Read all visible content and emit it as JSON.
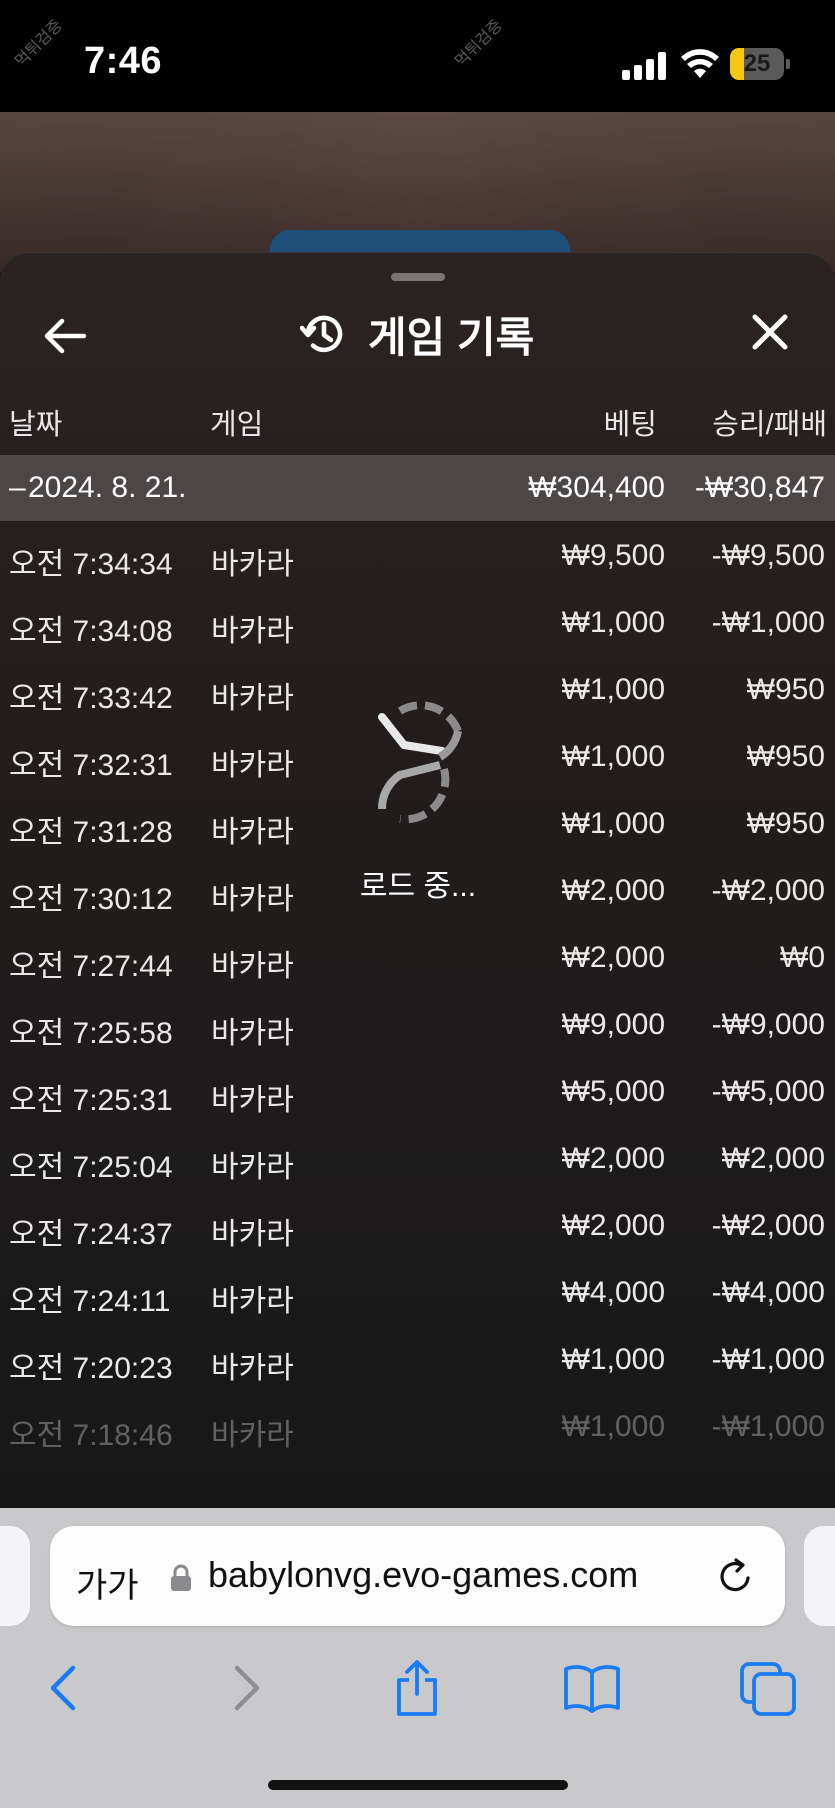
{
  "status_bar": {
    "time": "7:46",
    "battery": "25"
  },
  "sheet": {
    "title": "게임 기록",
    "columns": {
      "date": "날짜",
      "game": "게임",
      "bet": "베팅",
      "result": "승리/패배"
    },
    "date_group": {
      "date": "2024. 8. 21.",
      "bet_total": "₩304,400",
      "result_total": "-₩30,847"
    },
    "rows": [
      {
        "time": "오전 7:34:34",
        "game": "바카라",
        "bet": "₩9,500",
        "result": "-₩9,500"
      },
      {
        "time": "오전 7:34:08",
        "game": "바카라",
        "bet": "₩1,000",
        "result": "-₩1,000"
      },
      {
        "time": "오전 7:33:42",
        "game": "바카라",
        "bet": "₩1,000",
        "result": "₩950"
      },
      {
        "time": "오전 7:32:31",
        "game": "바카라",
        "bet": "₩1,000",
        "result": "₩950"
      },
      {
        "time": "오전 7:31:28",
        "game": "바카라",
        "bet": "₩1,000",
        "result": "₩950"
      },
      {
        "time": "오전 7:30:12",
        "game": "바카라",
        "bet": "₩2,000",
        "result": "-₩2,000"
      },
      {
        "time": "오전 7:27:44",
        "game": "바카라",
        "bet": "₩2,000",
        "result": "₩0"
      },
      {
        "time": "오전 7:25:58",
        "game": "바카라",
        "bet": "₩9,000",
        "result": "-₩9,000"
      },
      {
        "time": "오전 7:25:31",
        "game": "바카라",
        "bet": "₩5,000",
        "result": "-₩5,000"
      },
      {
        "time": "오전 7:25:04",
        "game": "바카라",
        "bet": "₩2,000",
        "result": "₩2,000"
      },
      {
        "time": "오전 7:24:37",
        "game": "바카라",
        "bet": "₩2,000",
        "result": "-₩2,000"
      },
      {
        "time": "오전 7:24:11",
        "game": "바카라",
        "bet": "₩4,000",
        "result": "-₩4,000"
      },
      {
        "time": "오전 7:20:23",
        "game": "바카라",
        "bet": "₩1,000",
        "result": "-₩1,000"
      },
      {
        "time": "오전 7:18:46",
        "game": "바카라",
        "bet": "₩1,000",
        "result": "-₩1,000"
      }
    ]
  },
  "loading": {
    "text": "로드 중..."
  },
  "browser": {
    "text_size_label": "가가",
    "url": "babylonvg.evo-games.com"
  },
  "watermark": "먹튀검증",
  "colors": {
    "battery": "#f5c518",
    "ios_blue": "#1a7cf5",
    "sheet_bg": "#221c1c"
  },
  "icons": [
    "signal-icon",
    "wifi-icon",
    "battery-icon",
    "back-arrow-icon",
    "history-icon",
    "close-icon",
    "loading-spinner-icon",
    "lock-icon",
    "reload-icon",
    "back-icon",
    "forward-icon",
    "share-icon",
    "bookmarks-icon",
    "tabs-icon"
  ]
}
